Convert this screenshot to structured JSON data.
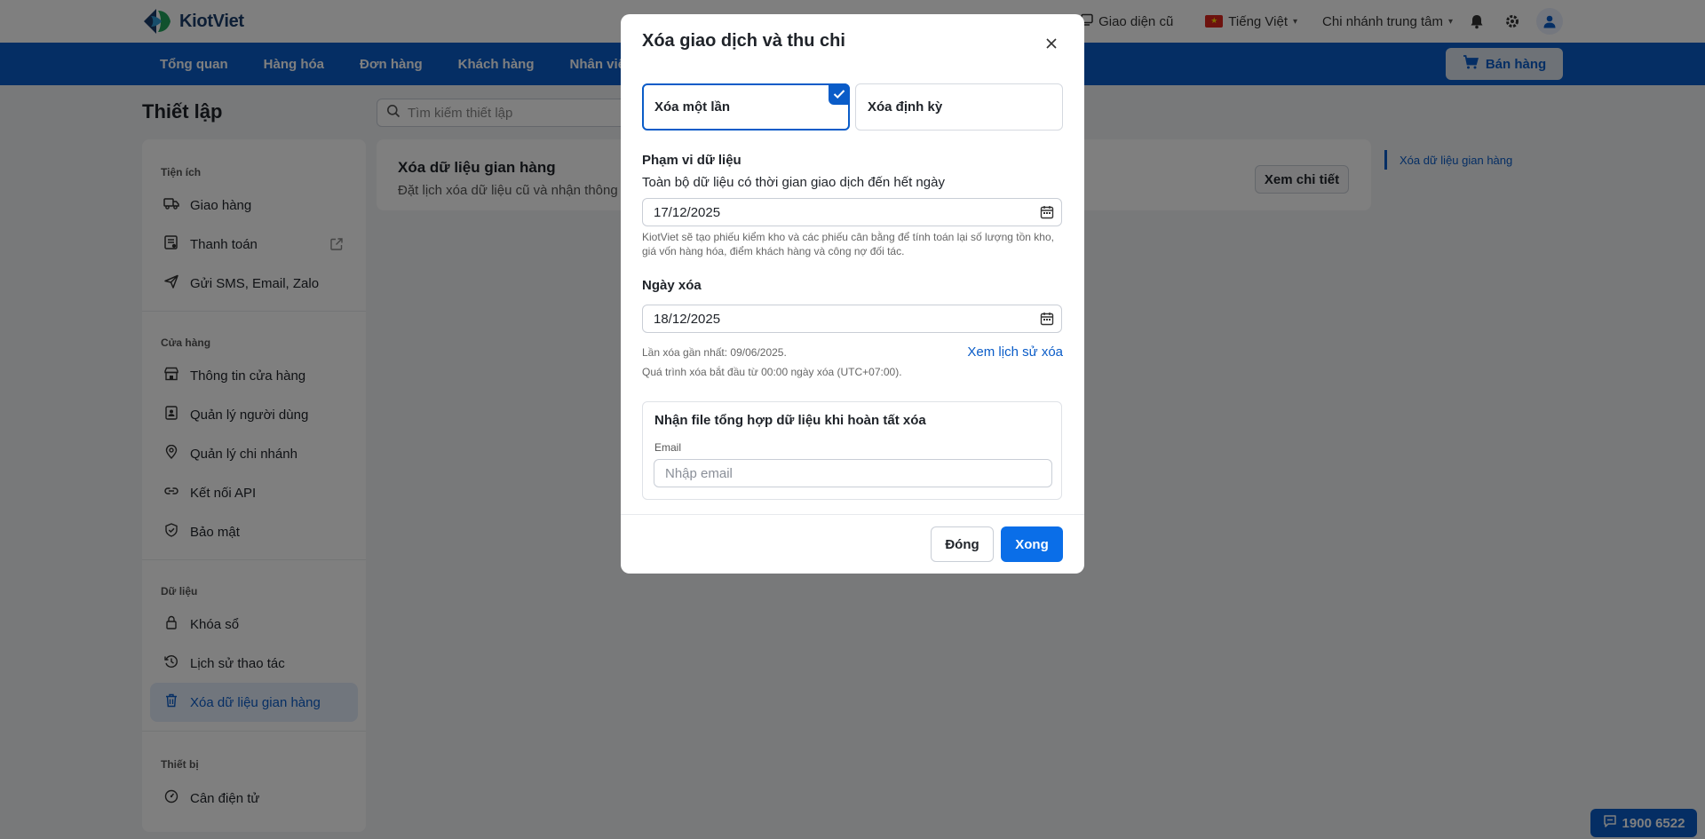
{
  "brand": {
    "name": "KiotViet"
  },
  "topbar": {
    "old_ui_label": "Giao diện cũ",
    "language_label": "Tiếng Việt",
    "branch_label": "Chi nhánh trung tâm"
  },
  "nav": {
    "items": [
      {
        "label": "Tổng quan"
      },
      {
        "label": "Hàng hóa"
      },
      {
        "label": "Đơn hàng"
      },
      {
        "label": "Khách hàng"
      },
      {
        "label": "Nhân viên"
      }
    ],
    "sell_button": "Bán hàng"
  },
  "page": {
    "title": "Thiết lập",
    "search_placeholder": "Tìm kiếm thiết lập"
  },
  "sidebar": {
    "groups": [
      {
        "title": "Tiện ích",
        "items": [
          {
            "label": "Giao hàng",
            "icon": "truck-icon"
          },
          {
            "label": "Thanh toán",
            "icon": "payment-icon"
          },
          {
            "label": "Gửi SMS, Email, Zalo",
            "icon": "send-icon"
          }
        ]
      },
      {
        "title": "Cửa hàng",
        "items": [
          {
            "label": "Thông tin cửa hàng",
            "icon": "store-icon"
          },
          {
            "label": "Quản lý người dùng",
            "icon": "user-badge-icon"
          },
          {
            "label": "Quản lý chi nhánh",
            "icon": "location-icon"
          },
          {
            "label": "Kết nối API",
            "icon": "link-icon"
          },
          {
            "label": "Bảo mật",
            "icon": "shield-icon"
          }
        ]
      },
      {
        "title": "Dữ liệu",
        "items": [
          {
            "label": "Khóa sổ",
            "icon": "lock-icon"
          },
          {
            "label": "Lịch sử thao tác",
            "icon": "history-icon"
          },
          {
            "label": "Xóa dữ liệu gian hàng",
            "icon": "trash-icon",
            "active": true
          }
        ]
      },
      {
        "title": "Thiết bị",
        "items": [
          {
            "label": "Cân điện tử",
            "icon": "scale-icon"
          }
        ]
      }
    ]
  },
  "content": {
    "card_title": "Xóa dữ liệu gian hàng",
    "card_subtitle": "Đặt lịch xóa dữ liệu cũ và nhận thông b",
    "detail_button": "Xem chi tiết",
    "toc_item": "Xóa dữ liệu gian hàng"
  },
  "hotline": "1900 6522",
  "modal": {
    "title": "Xóa giao dịch và thu chi",
    "options": [
      {
        "label": "Xóa một lần",
        "selected": true
      },
      {
        "label": "Xóa định kỳ",
        "selected": false
      }
    ],
    "scope_label": "Phạm vi dữ liệu",
    "scope_text": "Toàn bộ dữ liệu có thời gian giao dịch đến hết ngày",
    "scope_date": "17/12/2025",
    "scope_note": "KiotViet sẽ tạo phiếu kiểm kho và các phiếu cân bằng để tính toán lại số lượng tồn kho, giá vốn hàng hóa, điểm khách hàng và công nợ đối tác.",
    "delete_date_label": "Ngày xóa",
    "delete_date": "18/12/2025",
    "last_delete": "Lần xóa gần nhất: 09/06/2025.",
    "process_note": "Quá trình xóa bắt đầu từ 00:00 ngày xóa (UTC+07:00).",
    "history_link": "Xem lịch sử xóa",
    "email_section_title": "Nhận file tổng hợp dữ liệu khi hoàn tất xóa",
    "email_label": "Email",
    "email_placeholder": "Nhập email",
    "email_value": "",
    "close_button": "Đóng",
    "done_button": "Xong"
  },
  "colors": {
    "primary": "#0a5cc8",
    "active_bg": "#e3ecfb"
  }
}
